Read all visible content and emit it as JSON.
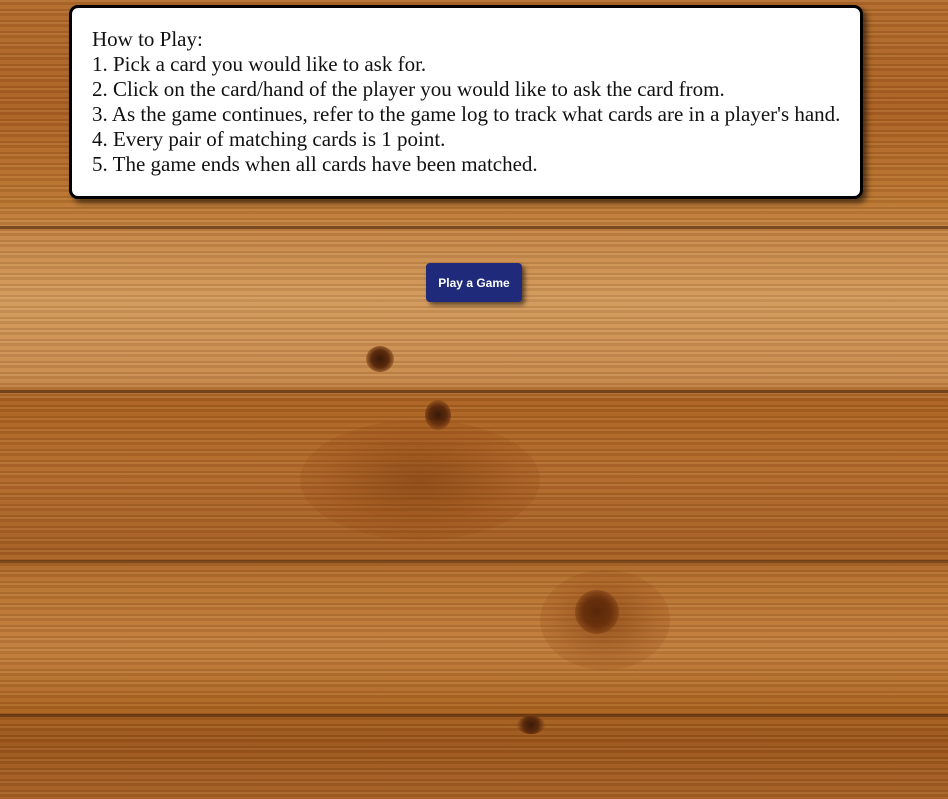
{
  "instructions": {
    "title": "How to Play:",
    "steps": [
      "1. Pick a card you would like to ask for.",
      "2. Click on the card/hand of the player you would like to ask the card from.",
      "3. As the game continues, refer to the game log to track what cards are in a player's hand.",
      "4. Every pair of matching cards is 1 point.",
      "5. The game ends when all cards have been matched."
    ]
  },
  "play_button": {
    "label": "Play a Game"
  },
  "colors": {
    "button_bg": "#1f2a7a",
    "panel_bg": "#ffffff",
    "table_wood": "#b06a2c"
  }
}
